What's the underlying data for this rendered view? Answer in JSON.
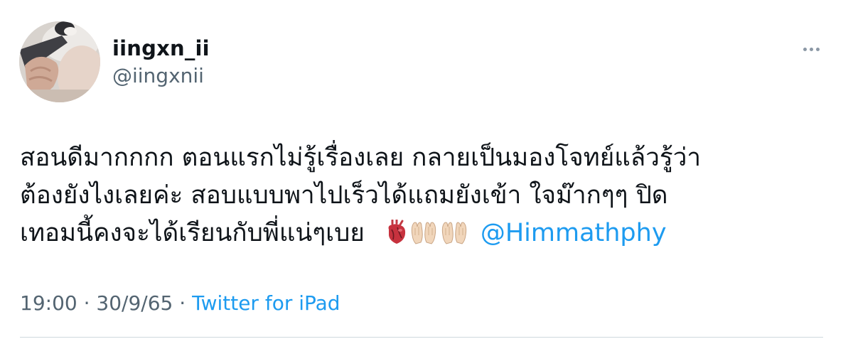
{
  "tweet": {
    "user": {
      "display_name": "iingxn_ii",
      "handle": "@iingxnii"
    },
    "text_lines": [
      "สอนดีมากกกก ตอนแรกไม่รู้เรื่องเลย กลายเป็นมองโจทย์แล้วรู้ว่า",
      "ต้องยังไงเลยค่ะ สอบแบบพาไปเร็วได้แถมยังเข้า ใจม๊ากๆๆ ปิด",
      "เทอมนี้คงจะได้เรียนกับพี่แน่ๆเบย"
    ],
    "emojis": [
      "anatomical-heart",
      "palms-up-together-light-skin",
      "palms-up-together-light-skin"
    ],
    "mention": "@Himmathphy",
    "meta": {
      "time": "19:00",
      "separator": "·",
      "date": "30/9/65",
      "source": "Twitter for iPad"
    },
    "colors": {
      "text": "#0f1419",
      "secondary": "#536471",
      "link": "#1d9bf0",
      "divider": "#cfd9de"
    }
  }
}
